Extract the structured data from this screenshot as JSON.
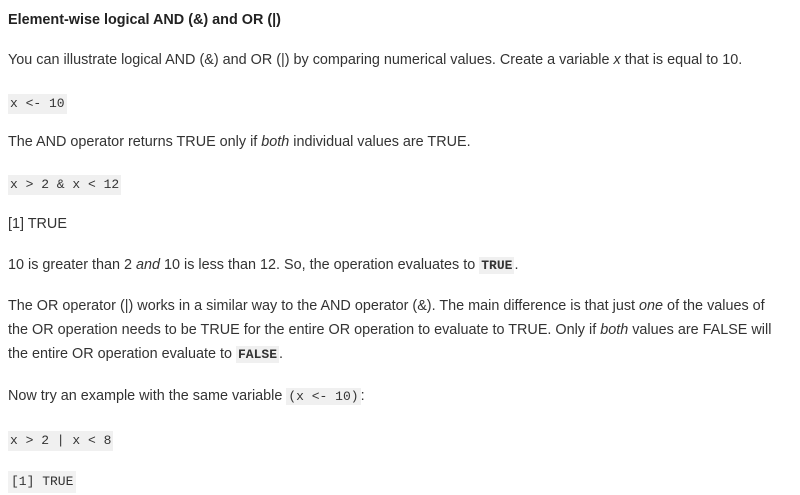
{
  "heading": "Element-wise logical AND (&) and OR (|)",
  "intro": {
    "part1": "You can illustrate logical AND (&) and OR (|) by comparing numerical values. Create a variable ",
    "var_name": "x",
    "part2": " that is equal to 10."
  },
  "code_assign": "x <- 10",
  "and_text": {
    "part1": "The AND operator returns TRUE only if ",
    "em": "both",
    "part2": " individual values are TRUE."
  },
  "code_and": "x > 2 & x < 12",
  "output_and": "[1] TRUE",
  "explain_and": {
    "part1": "10 is greater than 2 ",
    "em": "and",
    "part2": " 10 is less than 12. So, the operation evaluates to ",
    "code": "TRUE",
    "part3": "."
  },
  "or_text": {
    "line1_part1": "The OR operator (|) works in a similar way to the AND operator (&). The main difference is that just ",
    "line1_em": "one",
    "line1_part2": " of the values of",
    "line2_part1": "the OR operation needs to be TRUE for the entire OR operation to evaluate to TRUE. Only if ",
    "line2_em": "both",
    "line2_part2": " values are FALSE will",
    "line3_part1": "the entire OR operation evaluate to ",
    "line3_code": "FALSE",
    "line3_part2": "."
  },
  "try_text": {
    "part1": "Now try an example with the same variable ",
    "code": "(x <- 10)",
    "part2": ":"
  },
  "code_or": "x > 2 | x < 8",
  "output_or": "[1] TRUE"
}
